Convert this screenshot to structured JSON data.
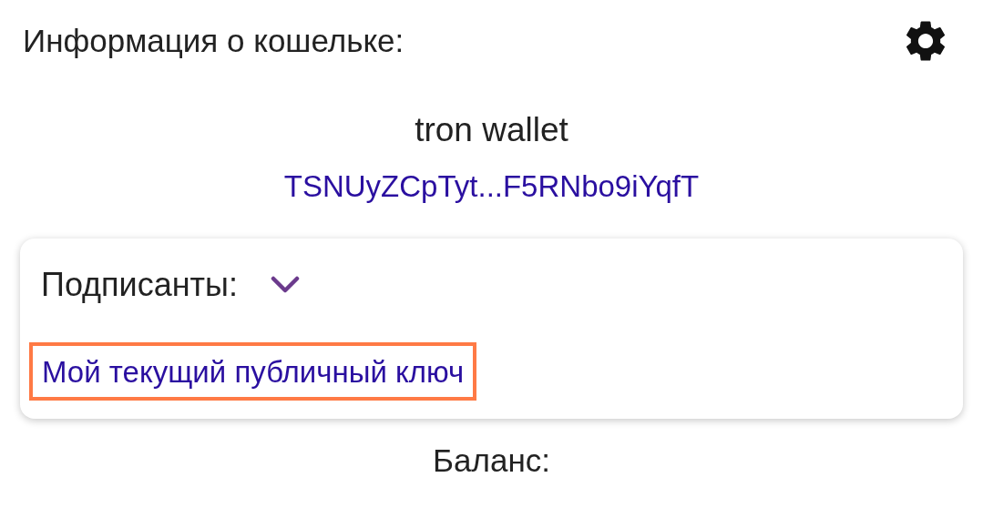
{
  "header": {
    "title": "Информация о кошельке:"
  },
  "wallet": {
    "name": "tron wallet",
    "address": "TSNUyZCpTyt...F5RNbo9iYqfT"
  },
  "signers": {
    "label": "Подписанты:",
    "expanded": false,
    "link": "Мой текущий публичный ключ",
    "highlighted": true
  },
  "balance": {
    "label": "Баланс:"
  }
}
